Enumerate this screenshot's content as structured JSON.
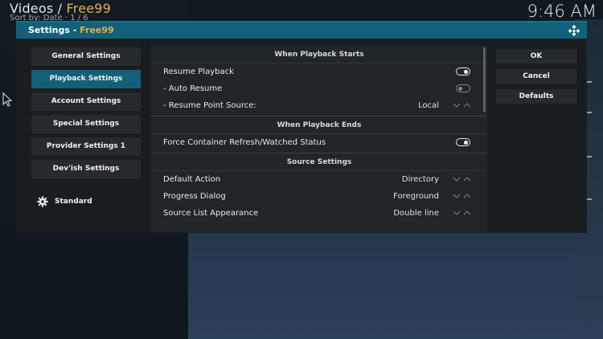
{
  "window": {
    "section": "Videos",
    "separator": " / ",
    "addon": "Free99",
    "sort_label": "Sort by: Date",
    "page_counter": "·  1 / 6",
    "clock": "9:46 AM"
  },
  "dialog": {
    "title": "Settings - ",
    "title_addon": "Free99",
    "categories": [
      "General Settings",
      "Playback Settings",
      "Account Settings",
      "Special Settings",
      "Provider Settings 1",
      "Dev'ish Settings"
    ],
    "active_category": 1,
    "level_label": "Standard",
    "sections": {
      "playback_starts": {
        "heading": "When Playback Starts",
        "rows": [
          {
            "label": "Resume Playback",
            "control": "toggle-on"
          },
          {
            "label": "- Auto Resume",
            "control": "toggle-off"
          },
          {
            "label": "- Resume Point Source:",
            "value": "Local",
            "control": "spinner"
          }
        ]
      },
      "playback_ends": {
        "heading": "When Playback Ends",
        "rows": [
          {
            "label": "Force Container Refresh/Watched Status",
            "control": "toggle-on"
          }
        ]
      },
      "source_settings": {
        "heading": "Source Settings",
        "rows": [
          {
            "label": "Default Action",
            "value": "Directory",
            "control": "spinner"
          },
          {
            "label": "Progress Dialog",
            "value": "Foreground",
            "control": "spinner"
          },
          {
            "label": "Source List Appearance",
            "value": "Double line",
            "control": "spinner"
          }
        ]
      }
    },
    "buttons": {
      "ok": "OK",
      "cancel": "Cancel",
      "defaults": "Defaults"
    }
  },
  "colors": {
    "accent": "#e3b04b",
    "header": "#13607a"
  }
}
